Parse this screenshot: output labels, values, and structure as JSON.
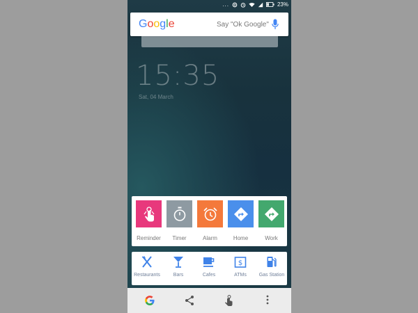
{
  "status_bar": {
    "battery": "23%",
    "icons": [
      "more-dots-icon",
      "data-saver-icon",
      "alarm-icon",
      "wifi-icon",
      "signal-icon",
      "battery-icon"
    ]
  },
  "search": {
    "logo": [
      "G",
      "o",
      "o",
      "g",
      "l",
      "e"
    ],
    "logo_colors": [
      "#4285F4",
      "#EA4335",
      "#FBBC05",
      "#4285F4",
      "#34A853",
      "#EA4335"
    ],
    "hint": "Say \"Ok Google\"",
    "mic_color": "#4285F4"
  },
  "lockscreen": {
    "time": "15:35",
    "date": "Sat, 04 March"
  },
  "actions": [
    {
      "label": "Reminder",
      "color": "#E8387C",
      "icon": "reminder-icon"
    },
    {
      "label": "Timer",
      "color": "#8E9AA2",
      "icon": "timer-icon"
    },
    {
      "label": "Alarm",
      "color": "#F4793B",
      "icon": "alarm-icon"
    },
    {
      "label": "Home",
      "color": "#4A8FEB",
      "icon": "directions-icon"
    },
    {
      "label": "Work",
      "color": "#43A86E",
      "icon": "directions-icon"
    }
  ],
  "places": [
    {
      "label": "Restaurants",
      "icon": "fork-knife-icon"
    },
    {
      "label": "Bars",
      "icon": "cocktail-icon"
    },
    {
      "label": "Cafes",
      "icon": "coffee-cup-icon"
    },
    {
      "label": "ATMs",
      "icon": "atm-icon"
    },
    {
      "label": "Gas Station",
      "icon": "gas-pump-icon"
    }
  ],
  "places_color": "#3F82E8",
  "nav": [
    "google-g-icon",
    "share-icon",
    "touch-icon",
    "more-vert-icon"
  ]
}
